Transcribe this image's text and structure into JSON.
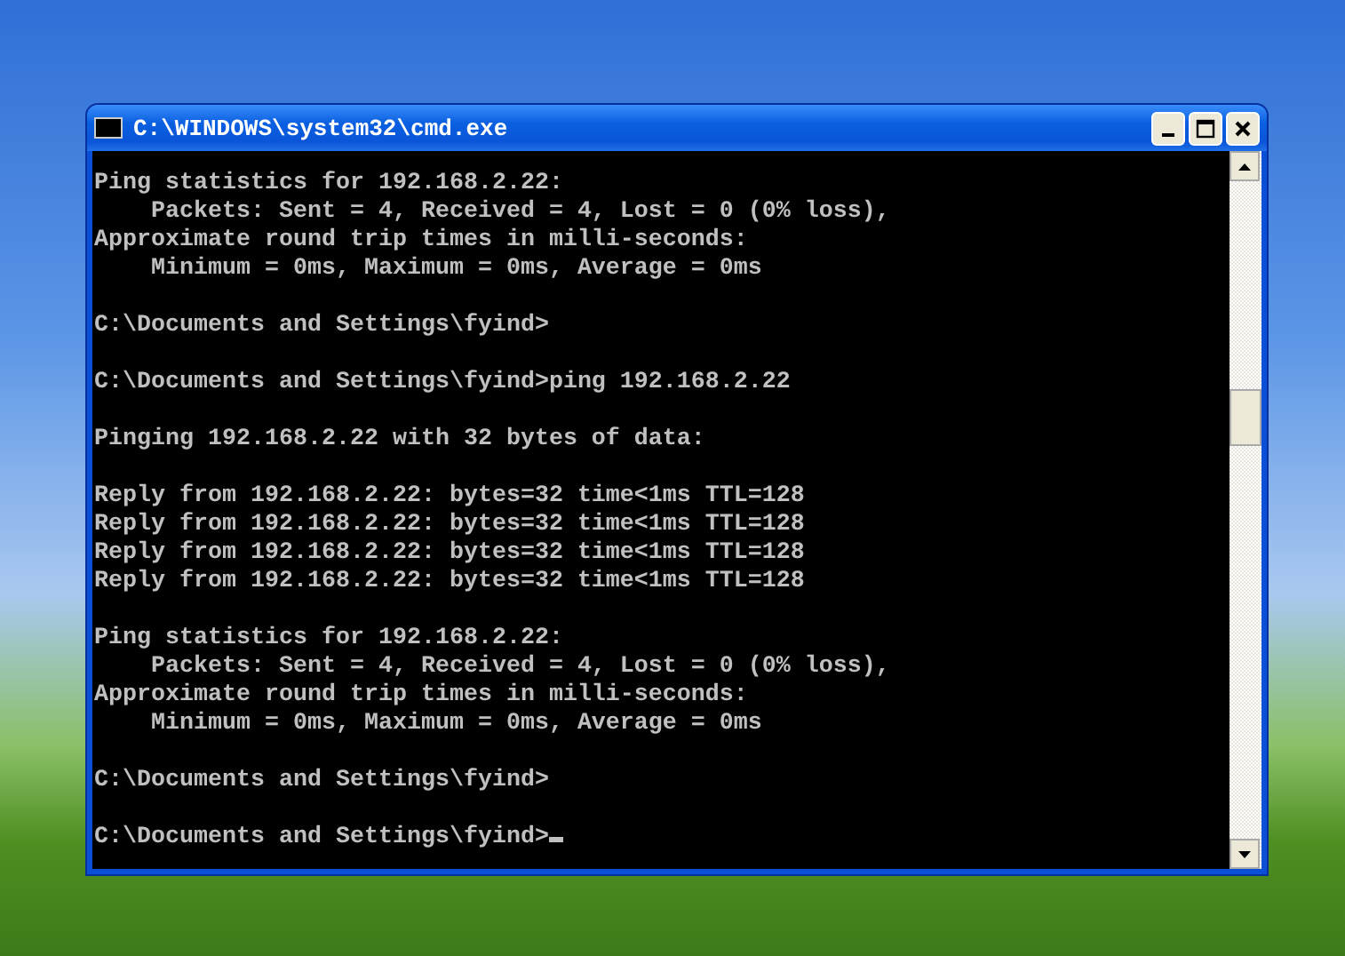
{
  "window": {
    "title": "C:\\WINDOWS\\system32\\cmd.exe"
  },
  "console": {
    "blocks": [
      [
        "Ping statistics for 192.168.2.22:",
        "    Packets: Sent = 4, Received = 4, Lost = 0 (0% loss),",
        "Approximate round trip times in milli-seconds:",
        "    Minimum = 0ms, Maximum = 0ms, Average = 0ms"
      ],
      [
        "C:\\Documents and Settings\\fyind>"
      ],
      [
        "C:\\Documents and Settings\\fyind>ping 192.168.2.22"
      ],
      [
        "Pinging 192.168.2.22 with 32 bytes of data:"
      ],
      [
        "Reply from 192.168.2.22: bytes=32 time<1ms TTL=128",
        "Reply from 192.168.2.22: bytes=32 time<1ms TTL=128",
        "Reply from 192.168.2.22: bytes=32 time<1ms TTL=128",
        "Reply from 192.168.2.22: bytes=32 time<1ms TTL=128"
      ],
      [
        "Ping statistics for 192.168.2.22:",
        "    Packets: Sent = 4, Received = 4, Lost = 0 (0% loss),",
        "Approximate round trip times in milli-seconds:",
        "    Minimum = 0ms, Maximum = 0ms, Average = 0ms"
      ],
      [
        "C:\\Documents and Settings\\fyind>"
      ],
      [
        "C:\\Documents and Settings\\fyind>"
      ]
    ],
    "cursor_visible": true
  }
}
